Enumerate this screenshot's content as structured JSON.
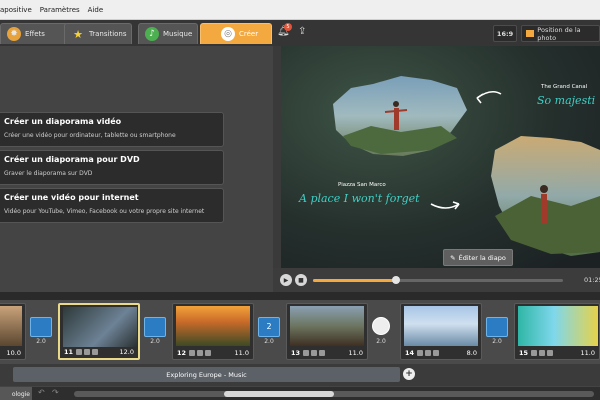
{
  "menu": {
    "items": [
      "apositive",
      "Paramètres",
      "Aide"
    ]
  },
  "tabs": [
    {
      "label": "Effets",
      "icon": "palette-icon"
    },
    {
      "label": "Transitions",
      "icon": "star-icon"
    },
    {
      "label": "Musique",
      "icon": "music-icon"
    },
    {
      "label": "Créer",
      "icon": "film-reel-icon",
      "active": true
    }
  ],
  "toolbar": {
    "notification_count": "5",
    "aspect_ratio": "16:9",
    "photo_position_label": "Position de la photo"
  },
  "create_options": [
    {
      "title": "Créer un diaporama vidéo",
      "subtitle": "Créer une vidéo pour ordinateur, tablette ou smartphone"
    },
    {
      "title": "Créer un diaporama pour DVD",
      "subtitle": "Graver le diaporama sur DVD"
    },
    {
      "title": "Créer une vidéo pour internet",
      "subtitle": "Vidéo pour YouTube, Vimeo, Facebook ou votre propre site internet"
    }
  ],
  "preview": {
    "caption1_small": "The Grand Canal",
    "caption1_script": "So majesti",
    "caption2_small": "Piazza San Marco",
    "caption2_script": "A place I won't forget",
    "edit_button": "Éditer la diapo"
  },
  "player": {
    "time": "01:25",
    "progress": 0.33
  },
  "timeline": {
    "slides": [
      {
        "number": "",
        "duration": "10.0"
      },
      {
        "number": "11",
        "duration": "12.0"
      },
      {
        "number": "12",
        "duration": "11.0"
      },
      {
        "number": "13",
        "duration": "11.0"
      },
      {
        "number": "14",
        "duration": "8.0"
      },
      {
        "number": "15",
        "duration": "11.0"
      }
    ],
    "transitions": [
      {
        "label": "",
        "duration": "2.0"
      },
      {
        "label": "",
        "duration": "2.0"
      },
      {
        "label": "2",
        "duration": "2.0"
      },
      {
        "label": "",
        "duration": "2.0"
      },
      {
        "label": "",
        "duration": "2.0"
      }
    ]
  },
  "audio": {
    "track": "Exploring Europe - Music"
  },
  "bottom": {
    "tab": "ologie"
  },
  "colors": {
    "accent": "#f3a940",
    "transition": "#2b7cc2"
  }
}
